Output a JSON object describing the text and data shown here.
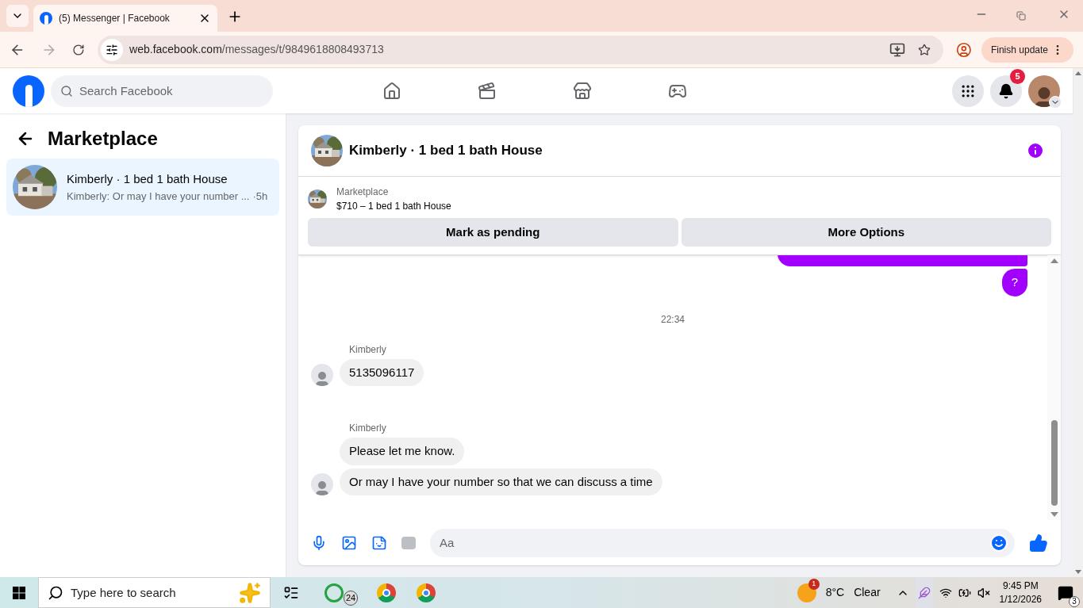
{
  "browser": {
    "tab": {
      "title": "(5) Messenger | Facebook",
      "selected": true
    },
    "address": {
      "host": "web.facebook.com",
      "path": "/messages/t/9849618808493713"
    },
    "update_button": "Finish update"
  },
  "header": {
    "search": {
      "placeholder": "Search Facebook"
    },
    "notification_count": "5"
  },
  "sidebar": {
    "title": "Marketplace",
    "conversations": [
      {
        "name": "Kimberly · 1 bed 1 bath House",
        "preview": "Kimberly: Or may I have your number ...",
        "time": "·5h",
        "selected": true
      }
    ]
  },
  "chat": {
    "title": "Kimberly · 1 bed 1 bath House",
    "listing": {
      "label": "Marketplace",
      "title": "$710 – 1 bed 1 bath House"
    },
    "actions": [
      "Mark as pending",
      "More Options"
    ],
    "thread": [
      {
        "kind": "outgoing",
        "texts": [
          "?"
        ]
      },
      {
        "kind": "time",
        "text": "22:34"
      },
      {
        "kind": "incoming",
        "sender": "Kimberly",
        "texts": [
          "5135096117"
        ]
      },
      {
        "kind": "incoming",
        "sender": "Kimberly",
        "texts": [
          "Please let me know.",
          "Or may I have your number so that we can discuss a time"
        ]
      }
    ],
    "composer": {
      "placeholder": "Aa"
    }
  },
  "taskbar": {
    "search": {
      "placeholder": "Type here to search"
    },
    "whatsapp_badge": "24",
    "weather": {
      "badge": "1",
      "temperature": "8°C",
      "condition": "Clear"
    },
    "time": "9:45 PM",
    "date": "1/12/2026",
    "notification_count": "3"
  }
}
